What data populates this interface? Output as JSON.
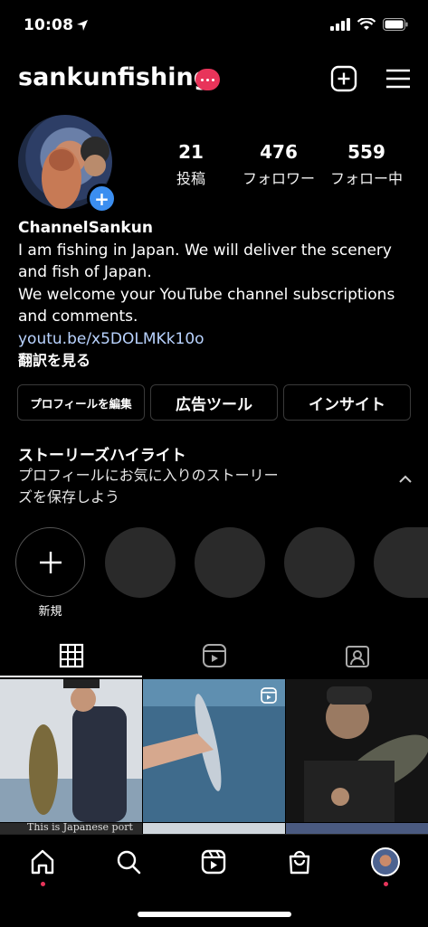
{
  "status_bar": {
    "time": "10:08"
  },
  "header": {
    "username": "sankunfishing"
  },
  "profile": {
    "stats": [
      {
        "value": "21",
        "label": "投稿"
      },
      {
        "value": "476",
        "label": "フォロワー"
      },
      {
        "value": "559",
        "label": "フォロー中"
      }
    ],
    "display_name": "ChannelSankun",
    "bio_lines": [
      "I am fishing in Japan. We will deliver the scenery",
      "and fish of Japan.",
      "We welcome your YouTube channel subscriptions",
      "and comments."
    ],
    "link": "youtu.be/x5DOLMKk10o",
    "translate": "翻訳を見る"
  },
  "buttons": {
    "edit_profile": "プロフィールを編集",
    "ad_tools": "広告ツール",
    "insights": "インサイト"
  },
  "highlights": {
    "title": "ストーリーズハイライト",
    "desc_line1": "プロフィールにお気に入りのストーリー",
    "desc_line2": "ズを保存しよう",
    "new_label": "新規"
  },
  "posts": {
    "caption_partial": "This is Japanese port fishing"
  },
  "colors": {
    "accent": "#3b8ef0",
    "badge": "#e8345a",
    "link": "#b9d3ff"
  }
}
